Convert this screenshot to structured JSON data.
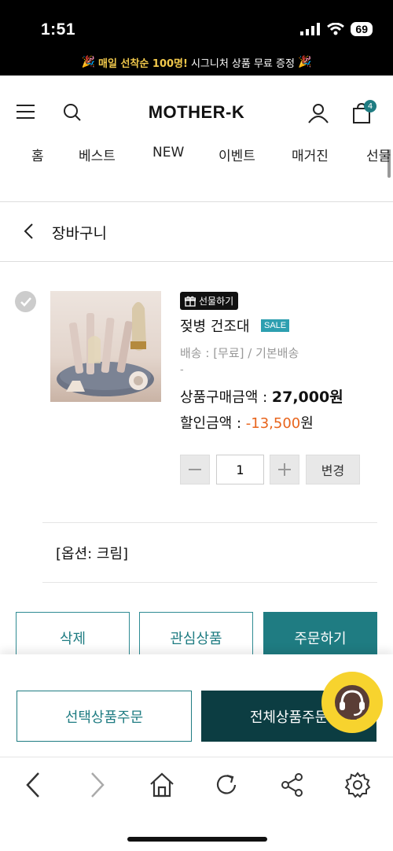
{
  "status_bar": {
    "time": "1:51",
    "battery": "69"
  },
  "promo": {
    "highlight": "매일 선착순 100명!",
    "rest": "시그니처 상품 무료 증정"
  },
  "header": {
    "logo": "MOTHER-K",
    "cart_count": "4",
    "nav": [
      "홈",
      "베스트",
      "NEW",
      "이벤트",
      "매거진",
      "선물"
    ]
  },
  "page": {
    "title": "장바구니"
  },
  "product": {
    "gift_label": "선물하기",
    "name": "젖병 건조대",
    "sale_label": "SALE",
    "shipping": "배송 : [무료] / 기본배송",
    "dash": "-",
    "price_label": "상품구매금액 : ",
    "price_value": "27,000",
    "price_unit": "원",
    "discount_label": "할인금액 : ",
    "discount_value": "-13,500",
    "discount_unit": "원",
    "quantity": "1",
    "change_label": "변경",
    "option": "[옵션: 크림]"
  },
  "actions": {
    "delete": "삭제",
    "wishlist": "관심상품",
    "order": "주문하기"
  },
  "bottom": {
    "selected_order": "선택상품주문",
    "all_order": "전체상품주문"
  },
  "colors": {
    "accent": "#1f7c82",
    "dark_teal": "#0c3d42",
    "discount": "#e8641c",
    "chat": "#f7d32e"
  }
}
